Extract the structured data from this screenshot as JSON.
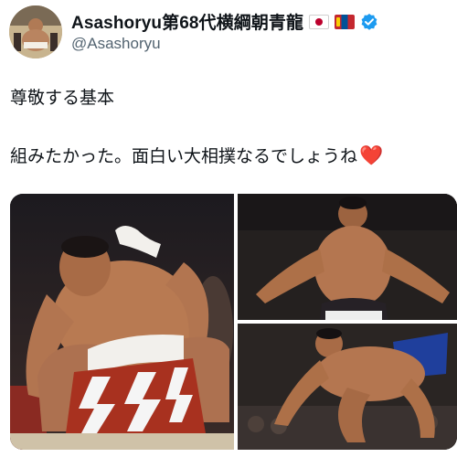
{
  "header": {
    "display_name": "Asashoryu第68代横綱朝青龍",
    "handle": "@Asashoryu",
    "flags": [
      "flag-japan-icon",
      "flag-mongolia-icon"
    ],
    "verified_icon": "verified-badge-icon"
  },
  "tweet": {
    "line1": "尊敬する基本",
    "line2": "組みたかった。面白い大相撲なるでしょうね",
    "emoji": "❤️"
  },
  "media": {
    "photos": [
      "sumo-wrestler-crouch-photo",
      "sumo-wrestler-arms-spread-photo",
      "sumo-wrestler-lunge-photo"
    ]
  },
  "colors": {
    "text": "#0f1419",
    "secondary": "#536471",
    "verified": "#1d9bf0",
    "heart": "#dd2e44"
  }
}
